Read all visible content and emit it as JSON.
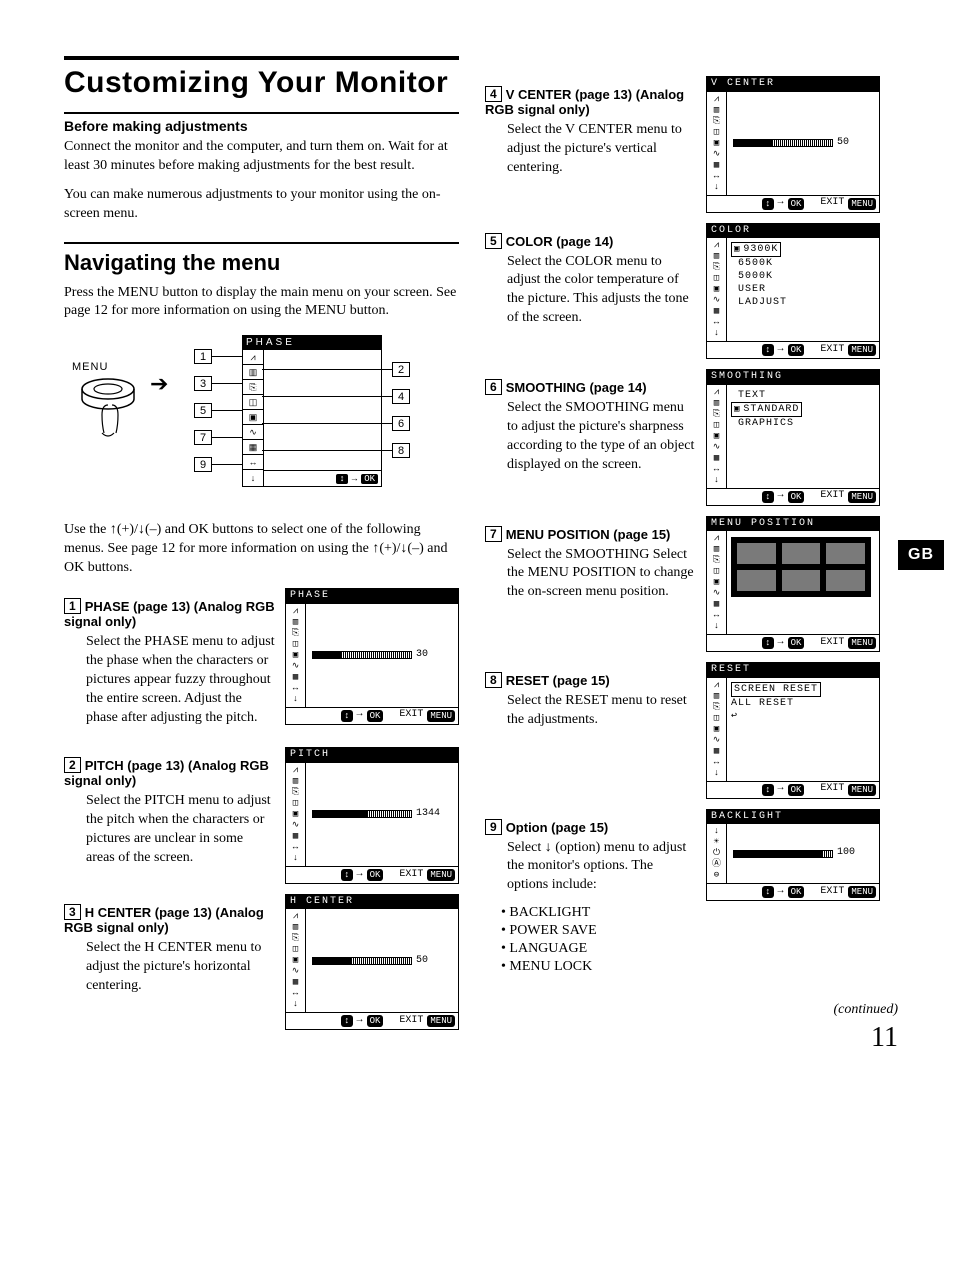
{
  "side_tab": "GB",
  "h1": "Customizing Your Monitor",
  "before_title": "Before making adjustments",
  "before_p1": "Connect the monitor and the computer, and turn them on. Wait for at least 30 minutes before making adjustments for the best result.",
  "before_p2": "You can make numerous adjustments to your monitor using the on-screen menu.",
  "nav_title": "Navigating the menu",
  "nav_p": "Press the MENU button to display the main menu on your screen. See page 12 for more information on using the MENU button.",
  "menu_label": "MENU",
  "diag_osd_title": "PHASE",
  "use_p": "Use the ↑(+)/↓(–) and OK buttons to select one of the following menus. See page 12 for more information on using the ↑(+)/↓(–) and OK buttons.",
  "callouts": [
    "1",
    "2",
    "3",
    "4",
    "5",
    "6",
    "7",
    "8",
    "9"
  ],
  "items_left": [
    {
      "num": "1",
      "head": "PHASE (page 13) (Analog RGB signal only)",
      "body": "Select the PHASE menu to adjust the phase when the characters or pictures appear fuzzy throughout the entire screen. Adjust the phase after adjusting the pitch.",
      "osd_title": "PHASE",
      "osd_value": "30",
      "slider_pct": 30
    },
    {
      "num": "2",
      "head": "PITCH (page 13) (Analog RGB signal only)",
      "body": "Select the PITCH menu to adjust the pitch when the characters or pictures are unclear in some areas of the screen.",
      "osd_title": "PITCH",
      "osd_value": "1344",
      "slider_pct": 55
    },
    {
      "num": "3",
      "head": "H CENTER (page 13) (Analog RGB signal only)",
      "body": "Select the H CENTER menu to adjust the picture's horizontal centering.",
      "osd_title": "H CENTER",
      "osd_value": "50",
      "slider_pct": 40
    }
  ],
  "items_right": [
    {
      "num": "4",
      "type": "slider",
      "head": "V CENTER (page 13) (Analog RGB signal only)",
      "body": "Select the V CENTER menu to adjust the picture's vertical centering.",
      "osd_title": "V CENTER",
      "osd_value": "50",
      "slider_pct": 40
    },
    {
      "num": "5",
      "type": "list",
      "head": "COLOR (page 14)",
      "body": "Select the COLOR menu to adjust the color temperature of the picture. This adjusts the tone of the screen.",
      "osd_title": "COLOR",
      "list": [
        "9300K",
        "6500K",
        "5000K",
        "USER",
        "LADJUST"
      ],
      "selected": 0
    },
    {
      "num": "6",
      "type": "list",
      "head": "SMOOTHING (page 14)",
      "body": "Select the SMOOTHING menu to adjust the picture's sharpness according to the type of an object displayed on the screen.",
      "osd_title": "SMOOTHING",
      "list": [
        "TEXT",
        "STANDARD",
        "GRAPHICS"
      ],
      "selected": 1
    },
    {
      "num": "7",
      "type": "grid",
      "head": "MENU POSITION (page 15)",
      "body": "Select the SMOOTHING Select the MENU POSITION to change the on-screen menu position.",
      "osd_title": "MENU POSITION"
    },
    {
      "num": "8",
      "type": "listreset",
      "head": "RESET (page 15)",
      "body": "Select the RESET menu to reset the adjustments.",
      "osd_title": "RESET",
      "list": [
        "SCREEN RESET",
        "ALL RESET"
      ],
      "selected": 0
    },
    {
      "num": "9",
      "type": "option",
      "head": "Option (page 15)",
      "body": "Select ↓ (option) menu to adjust the monitor's options. The options include:",
      "opts": [
        "BACKLIGHT",
        "POWER SAVE",
        "LANGUAGE",
        "MENU LOCK"
      ],
      "osd_title": "BACKLIGHT",
      "osd_value": "100",
      "slider_pct": 90
    }
  ],
  "osd_foot": {
    "left": "↕",
    "arrow": "→",
    "ok": "OK",
    "exit": "EXIT",
    "menu": "MENU"
  },
  "footnote": "(continued)",
  "page_num": "11"
}
